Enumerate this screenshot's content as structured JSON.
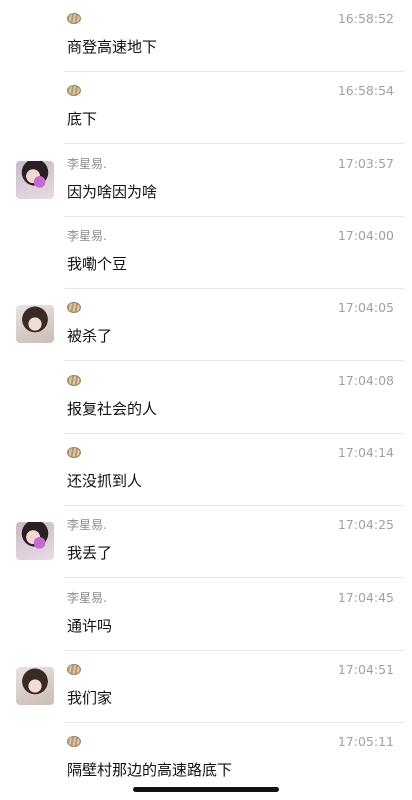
{
  "messages": [
    {
      "sender": "",
      "sender_icon": "shell-icon",
      "avatar": "",
      "time": "16:58:52",
      "text": "商登高速地下"
    },
    {
      "sender": "",
      "sender_icon": "shell-icon",
      "avatar": "",
      "time": "16:58:54",
      "text": "底下"
    },
    {
      "sender": "李星易.",
      "sender_icon": "",
      "avatar": "girl1",
      "time": "17:03:57",
      "text": "因为啥因为啥"
    },
    {
      "sender": "李星易.",
      "sender_icon": "",
      "avatar": "",
      "time": "17:04:00",
      "text": "我嘞个豆"
    },
    {
      "sender": "",
      "sender_icon": "shell-icon",
      "avatar": "girl2",
      "time": "17:04:05",
      "text": "被杀了"
    },
    {
      "sender": "",
      "sender_icon": "shell-icon",
      "avatar": "",
      "time": "17:04:08",
      "text": "报复社会的人"
    },
    {
      "sender": "",
      "sender_icon": "shell-icon",
      "avatar": "",
      "time": "17:04:14",
      "text": "还没抓到人"
    },
    {
      "sender": "李星易.",
      "sender_icon": "",
      "avatar": "girl1",
      "time": "17:04:25",
      "text": "我丢了"
    },
    {
      "sender": "李星易.",
      "sender_icon": "",
      "avatar": "",
      "time": "17:04:45",
      "text": "通许吗"
    },
    {
      "sender": "",
      "sender_icon": "shell-icon",
      "avatar": "girl2",
      "time": "17:04:51",
      "text": "我们家"
    },
    {
      "sender": "",
      "sender_icon": "shell-icon",
      "avatar": "",
      "time": "17:05:11",
      "text": "隔壁村那边的高速路底下"
    }
  ]
}
